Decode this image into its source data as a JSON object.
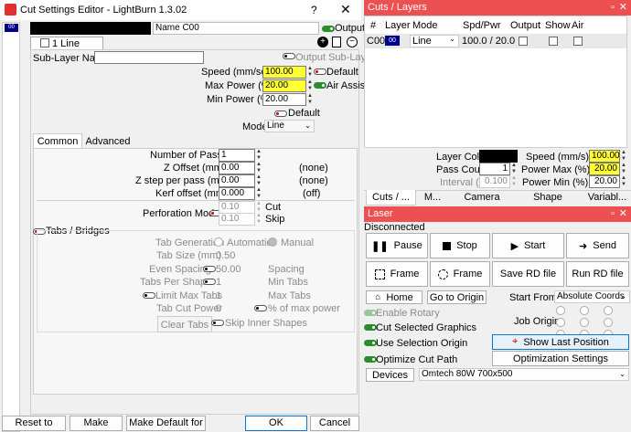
{
  "left_window": {
    "title": "Cut Settings Editor - LightBurn 1.3.02",
    "layer_list": [
      "00"
    ],
    "name_label": "Name C00",
    "output_label": "Output",
    "line_tab": "1 Line",
    "sublayer_name_label": "Sub-Layer Name",
    "output_sublayer_label": "Output Sub-Layer",
    "speed_label": "Speed (mm/sec)",
    "speed_value": "100.00",
    "default_label": "Default",
    "max_power_label": "Max Power (%)",
    "max_power_value": "20.00",
    "air_assist_label": "Air Assist",
    "min_power_label": "Min Power (%)",
    "min_power_value": "20.00",
    "default2_label": "Default",
    "mode_label": "Mode",
    "mode_value": "Line",
    "tabs": [
      "Common",
      "Advanced"
    ],
    "passes_label": "Number of Passes",
    "passes_value": "1",
    "zoffset_label": "Z Offset (mm)",
    "zoffset_value": "0.00",
    "zoffset_note": "(none)",
    "zstep_label": "Z step per pass (mm)",
    "zstep_value": "0.00",
    "zstep_note": "(none)",
    "kerf_label": "Kerf offset (mm)",
    "kerf_value": "0.000",
    "kerf_note": "(off)",
    "perforation_label": "Perforation Mode",
    "perf_cut_value": "0.10",
    "perf_cut_label": "Cut",
    "perf_skip_value": "0.10",
    "perf_skip_label": "Skip",
    "tabs_bridges_label": "Tabs / Bridges",
    "tab_gen_label": "Tab Generation",
    "tab_gen_auto": "Automatic",
    "tab_gen_manual": "Manual",
    "tab_size_label": "Tab Size (mm)",
    "tab_size_value": "0.50",
    "even_spacing_label": "Even Spacing",
    "even_spacing_value": "50.00",
    "spacing_label": "Spacing",
    "tabs_per_shape_label": "Tabs Per Shape",
    "tabs_per_shape_value": "1",
    "min_tabs_label": "Min Tabs",
    "limit_max_label": "Limit Max Tabs",
    "limit_max_value": "1",
    "max_tabs_label": "Max Tabs",
    "tab_cut_power_label": "Tab Cut Power",
    "tab_cut_power_value": "0",
    "pct_max_power_label": "% of max power",
    "clear_tabs": "Clear Tabs",
    "skip_inner_label": "Skip Inner Shapes",
    "buttons": {
      "reset": "Reset to Default",
      "make_default": "Make Default",
      "make_default_all": "Make Default for All",
      "ok": "OK",
      "cancel": "Cancel"
    }
  },
  "cuts_panel": {
    "title": "Cuts / Layers",
    "columns": [
      "#",
      "Layer",
      "Mode",
      "Spd/Pwr",
      "Output",
      "Show",
      "Air"
    ],
    "row": {
      "num": "C00",
      "layer": "00",
      "mode": "Line",
      "spdpwr": "100.0 / 20.0"
    },
    "layer_color_label": "Layer Color",
    "pass_count_label": "Pass Count",
    "pass_count_value": "1",
    "interval_label": "Interval (mm)",
    "interval_value": "0.100",
    "speed_label": "Speed (mm/s)",
    "speed_value": "100.00",
    "power_max_label": "Power Max (%)",
    "power_max_value": "20.00",
    "power_min_label": "Power Min (%)",
    "power_min_value": "20.00",
    "bottom_tabs": [
      "Cuts / ...",
      "M...",
      "Camera C...",
      "Shape Prop...",
      "Variabl..."
    ]
  },
  "laser_panel": {
    "title": "Laser",
    "status": "Disconnected",
    "pause": "Pause",
    "stop": "Stop",
    "start": "Start",
    "send": "Send",
    "frame1": "Frame",
    "frame2": "Frame",
    "save_rd": "Save RD file",
    "run_rd": "Run RD file",
    "home": "Home",
    "go_origin": "Go to Origin",
    "start_from_label": "Start From:",
    "start_from_value": "Absolute Coords",
    "enable_rotary": "Enable Rotary",
    "job_origin": "Job Origin",
    "cut_selected": "Cut Selected Graphics",
    "use_sel_origin": "Use Selection Origin",
    "show_last_pos": "Show Last Position",
    "optimize_cut": "Optimize Cut Path",
    "optimization_settings": "Optimization Settings",
    "devices": "Devices",
    "device_value": "Omtech 80W 700x500"
  },
  "colors": {
    "accent_red": "#ed5050",
    "highlight_yellow": "#ffff33",
    "layer_blue": "#00008b"
  }
}
